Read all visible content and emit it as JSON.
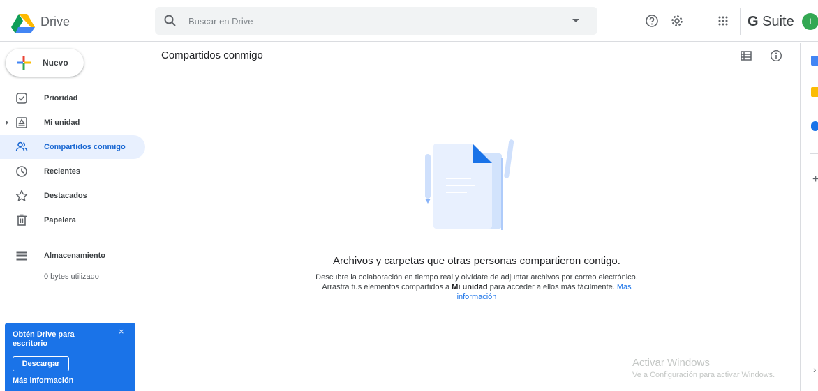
{
  "app": {
    "name": "Drive"
  },
  "search": {
    "placeholder": "Buscar en Drive",
    "value": ""
  },
  "header_icons": [
    "help-icon",
    "settings-icon",
    "apps-grid-icon"
  ],
  "gsuite": {
    "label_bold": "G",
    "label": "Suite",
    "avatar_initial": "I",
    "avatar_color": "#34a853"
  },
  "sidebar": {
    "new_button": "Nuevo",
    "items": [
      {
        "label": "Prioridad",
        "icon": "check-box-icon",
        "active": false
      },
      {
        "label": "Mi unidad",
        "icon": "my-drive-icon",
        "active": false,
        "expandable": true
      },
      {
        "label": "Compartidos conmigo",
        "icon": "shared-people-icon",
        "active": true
      },
      {
        "label": "Recientes",
        "icon": "clock-icon",
        "active": false
      },
      {
        "label": "Destacados",
        "icon": "star-icon",
        "active": false
      },
      {
        "label": "Papelera",
        "icon": "trash-icon",
        "active": false
      }
    ],
    "storage": {
      "label": "Almacenamiento",
      "used": "0 bytes utilizado"
    },
    "promo": {
      "title": "Obtén Drive para escritorio",
      "close": "×",
      "button": "Descargar",
      "link": "Más información"
    }
  },
  "main": {
    "title": "Compartidos conmigo",
    "empty_state": {
      "title": "Archivos y carpetas que otras personas compartieron contigo.",
      "desc_part1": "Descubre la colaboración en tiempo real y olvídate de adjuntar archivos por correo electrónico. Arrastra tus elementos compartidos a ",
      "desc_bold": "Mi unidad",
      "desc_part2": " para acceder a ellos más fácilmente. ",
      "link": "Más información"
    }
  },
  "watermark": {
    "line1": "Activar Windows",
    "line2": "Ve a Configuración para activar Windows."
  },
  "side_panel": {
    "icons": [
      "calendar-icon",
      "keep-icon",
      "tasks-icon"
    ],
    "add": "+",
    "expand": "›"
  },
  "colors": {
    "accent": "#1a73e8",
    "active_bg": "#e8f0fe",
    "active_text": "#1967d2"
  }
}
